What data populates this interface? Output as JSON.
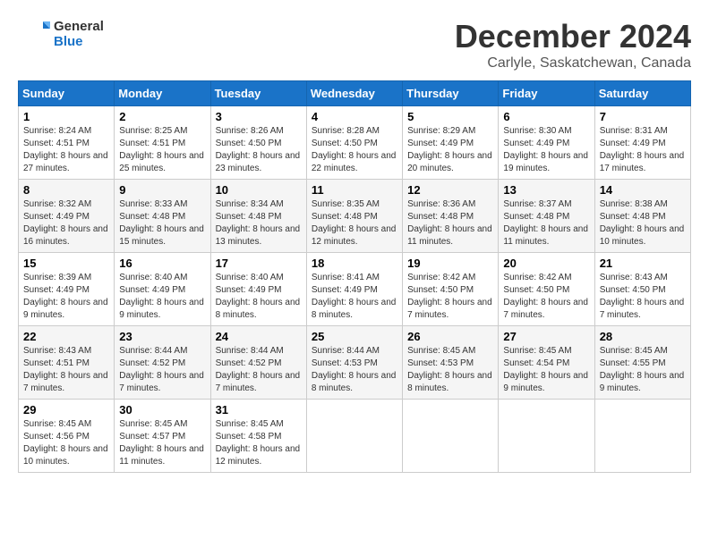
{
  "logo": {
    "line1": "General",
    "line2": "Blue"
  },
  "title": "December 2024",
  "subtitle": "Carlyle, Saskatchewan, Canada",
  "headers": [
    "Sunday",
    "Monday",
    "Tuesday",
    "Wednesday",
    "Thursday",
    "Friday",
    "Saturday"
  ],
  "weeks": [
    [
      {
        "day": "1",
        "sunrise": "8:24 AM",
        "sunset": "4:51 PM",
        "daylight": "8 hours and 27 minutes."
      },
      {
        "day": "2",
        "sunrise": "8:25 AM",
        "sunset": "4:51 PM",
        "daylight": "8 hours and 25 minutes."
      },
      {
        "day": "3",
        "sunrise": "8:26 AM",
        "sunset": "4:50 PM",
        "daylight": "8 hours and 23 minutes."
      },
      {
        "day": "4",
        "sunrise": "8:28 AM",
        "sunset": "4:50 PM",
        "daylight": "8 hours and 22 minutes."
      },
      {
        "day": "5",
        "sunrise": "8:29 AM",
        "sunset": "4:49 PM",
        "daylight": "8 hours and 20 minutes."
      },
      {
        "day": "6",
        "sunrise": "8:30 AM",
        "sunset": "4:49 PM",
        "daylight": "8 hours and 19 minutes."
      },
      {
        "day": "7",
        "sunrise": "8:31 AM",
        "sunset": "4:49 PM",
        "daylight": "8 hours and 17 minutes."
      }
    ],
    [
      {
        "day": "8",
        "sunrise": "8:32 AM",
        "sunset": "4:49 PM",
        "daylight": "8 hours and 16 minutes."
      },
      {
        "day": "9",
        "sunrise": "8:33 AM",
        "sunset": "4:48 PM",
        "daylight": "8 hours and 15 minutes."
      },
      {
        "day": "10",
        "sunrise": "8:34 AM",
        "sunset": "4:48 PM",
        "daylight": "8 hours and 13 minutes."
      },
      {
        "day": "11",
        "sunrise": "8:35 AM",
        "sunset": "4:48 PM",
        "daylight": "8 hours and 12 minutes."
      },
      {
        "day": "12",
        "sunrise": "8:36 AM",
        "sunset": "4:48 PM",
        "daylight": "8 hours and 11 minutes."
      },
      {
        "day": "13",
        "sunrise": "8:37 AM",
        "sunset": "4:48 PM",
        "daylight": "8 hours and 11 minutes."
      },
      {
        "day": "14",
        "sunrise": "8:38 AM",
        "sunset": "4:48 PM",
        "daylight": "8 hours and 10 minutes."
      }
    ],
    [
      {
        "day": "15",
        "sunrise": "8:39 AM",
        "sunset": "4:49 PM",
        "daylight": "8 hours and 9 minutes."
      },
      {
        "day": "16",
        "sunrise": "8:40 AM",
        "sunset": "4:49 PM",
        "daylight": "8 hours and 9 minutes."
      },
      {
        "day": "17",
        "sunrise": "8:40 AM",
        "sunset": "4:49 PM",
        "daylight": "8 hours and 8 minutes."
      },
      {
        "day": "18",
        "sunrise": "8:41 AM",
        "sunset": "4:49 PM",
        "daylight": "8 hours and 8 minutes."
      },
      {
        "day": "19",
        "sunrise": "8:42 AM",
        "sunset": "4:50 PM",
        "daylight": "8 hours and 7 minutes."
      },
      {
        "day": "20",
        "sunrise": "8:42 AM",
        "sunset": "4:50 PM",
        "daylight": "8 hours and 7 minutes."
      },
      {
        "day": "21",
        "sunrise": "8:43 AM",
        "sunset": "4:50 PM",
        "daylight": "8 hours and 7 minutes."
      }
    ],
    [
      {
        "day": "22",
        "sunrise": "8:43 AM",
        "sunset": "4:51 PM",
        "daylight": "8 hours and 7 minutes."
      },
      {
        "day": "23",
        "sunrise": "8:44 AM",
        "sunset": "4:52 PM",
        "daylight": "8 hours and 7 minutes."
      },
      {
        "day": "24",
        "sunrise": "8:44 AM",
        "sunset": "4:52 PM",
        "daylight": "8 hours and 7 minutes."
      },
      {
        "day": "25",
        "sunrise": "8:44 AM",
        "sunset": "4:53 PM",
        "daylight": "8 hours and 8 minutes."
      },
      {
        "day": "26",
        "sunrise": "8:45 AM",
        "sunset": "4:53 PM",
        "daylight": "8 hours and 8 minutes."
      },
      {
        "day": "27",
        "sunrise": "8:45 AM",
        "sunset": "4:54 PM",
        "daylight": "8 hours and 9 minutes."
      },
      {
        "day": "28",
        "sunrise": "8:45 AM",
        "sunset": "4:55 PM",
        "daylight": "8 hours and 9 minutes."
      }
    ],
    [
      {
        "day": "29",
        "sunrise": "8:45 AM",
        "sunset": "4:56 PM",
        "daylight": "8 hours and 10 minutes."
      },
      {
        "day": "30",
        "sunrise": "8:45 AM",
        "sunset": "4:57 PM",
        "daylight": "8 hours and 11 minutes."
      },
      {
        "day": "31",
        "sunrise": "8:45 AM",
        "sunset": "4:58 PM",
        "daylight": "8 hours and 12 minutes."
      },
      null,
      null,
      null,
      null
    ]
  ]
}
